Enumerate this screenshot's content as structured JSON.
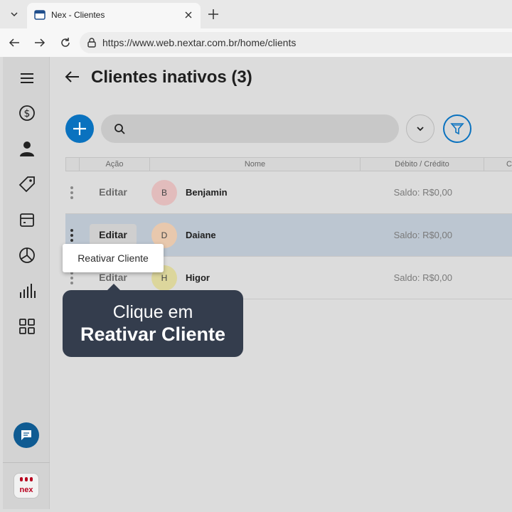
{
  "browser": {
    "tab_title": "Nex - Clientes",
    "url": "https://www.web.nextar.com.br/home/clients"
  },
  "sidebar": {
    "items": [
      "dollar-icon",
      "user-icon",
      "tag-icon",
      "box-icon",
      "pie-chart-icon",
      "bar-chart-icon",
      "grid-icon"
    ],
    "logo_text": "nex"
  },
  "page": {
    "title": "Clientes inativos",
    "count": "(3)"
  },
  "search": {
    "placeholder": ""
  },
  "table": {
    "headers": [
      "Ação",
      "Nome",
      "Débito / Crédito",
      "C"
    ],
    "rows": [
      {
        "action": "Editar",
        "initial": "B",
        "name": "Benjamin",
        "balance": "Saldo: R$0,00",
        "avatar_color": "#e2bcbc"
      },
      {
        "action": "Editar",
        "initial": "D",
        "name": "Daiane",
        "balance": "Saldo: R$0,00",
        "avatar_color": "#e8c8ad"
      },
      {
        "action": "Editar",
        "initial": "H",
        "name": "Higor",
        "balance": "Saldo: R$0,00",
        "avatar_color": "#dcd69c"
      }
    ]
  },
  "context_menu": {
    "item": "Reativar Cliente"
  },
  "tooltip": {
    "line1": "Clique em",
    "line2": "Reativar Cliente"
  },
  "colors": {
    "primary": "#0a72bf",
    "tooltip_bg": "#343d4d",
    "selected_row": "#bcc6d1"
  }
}
